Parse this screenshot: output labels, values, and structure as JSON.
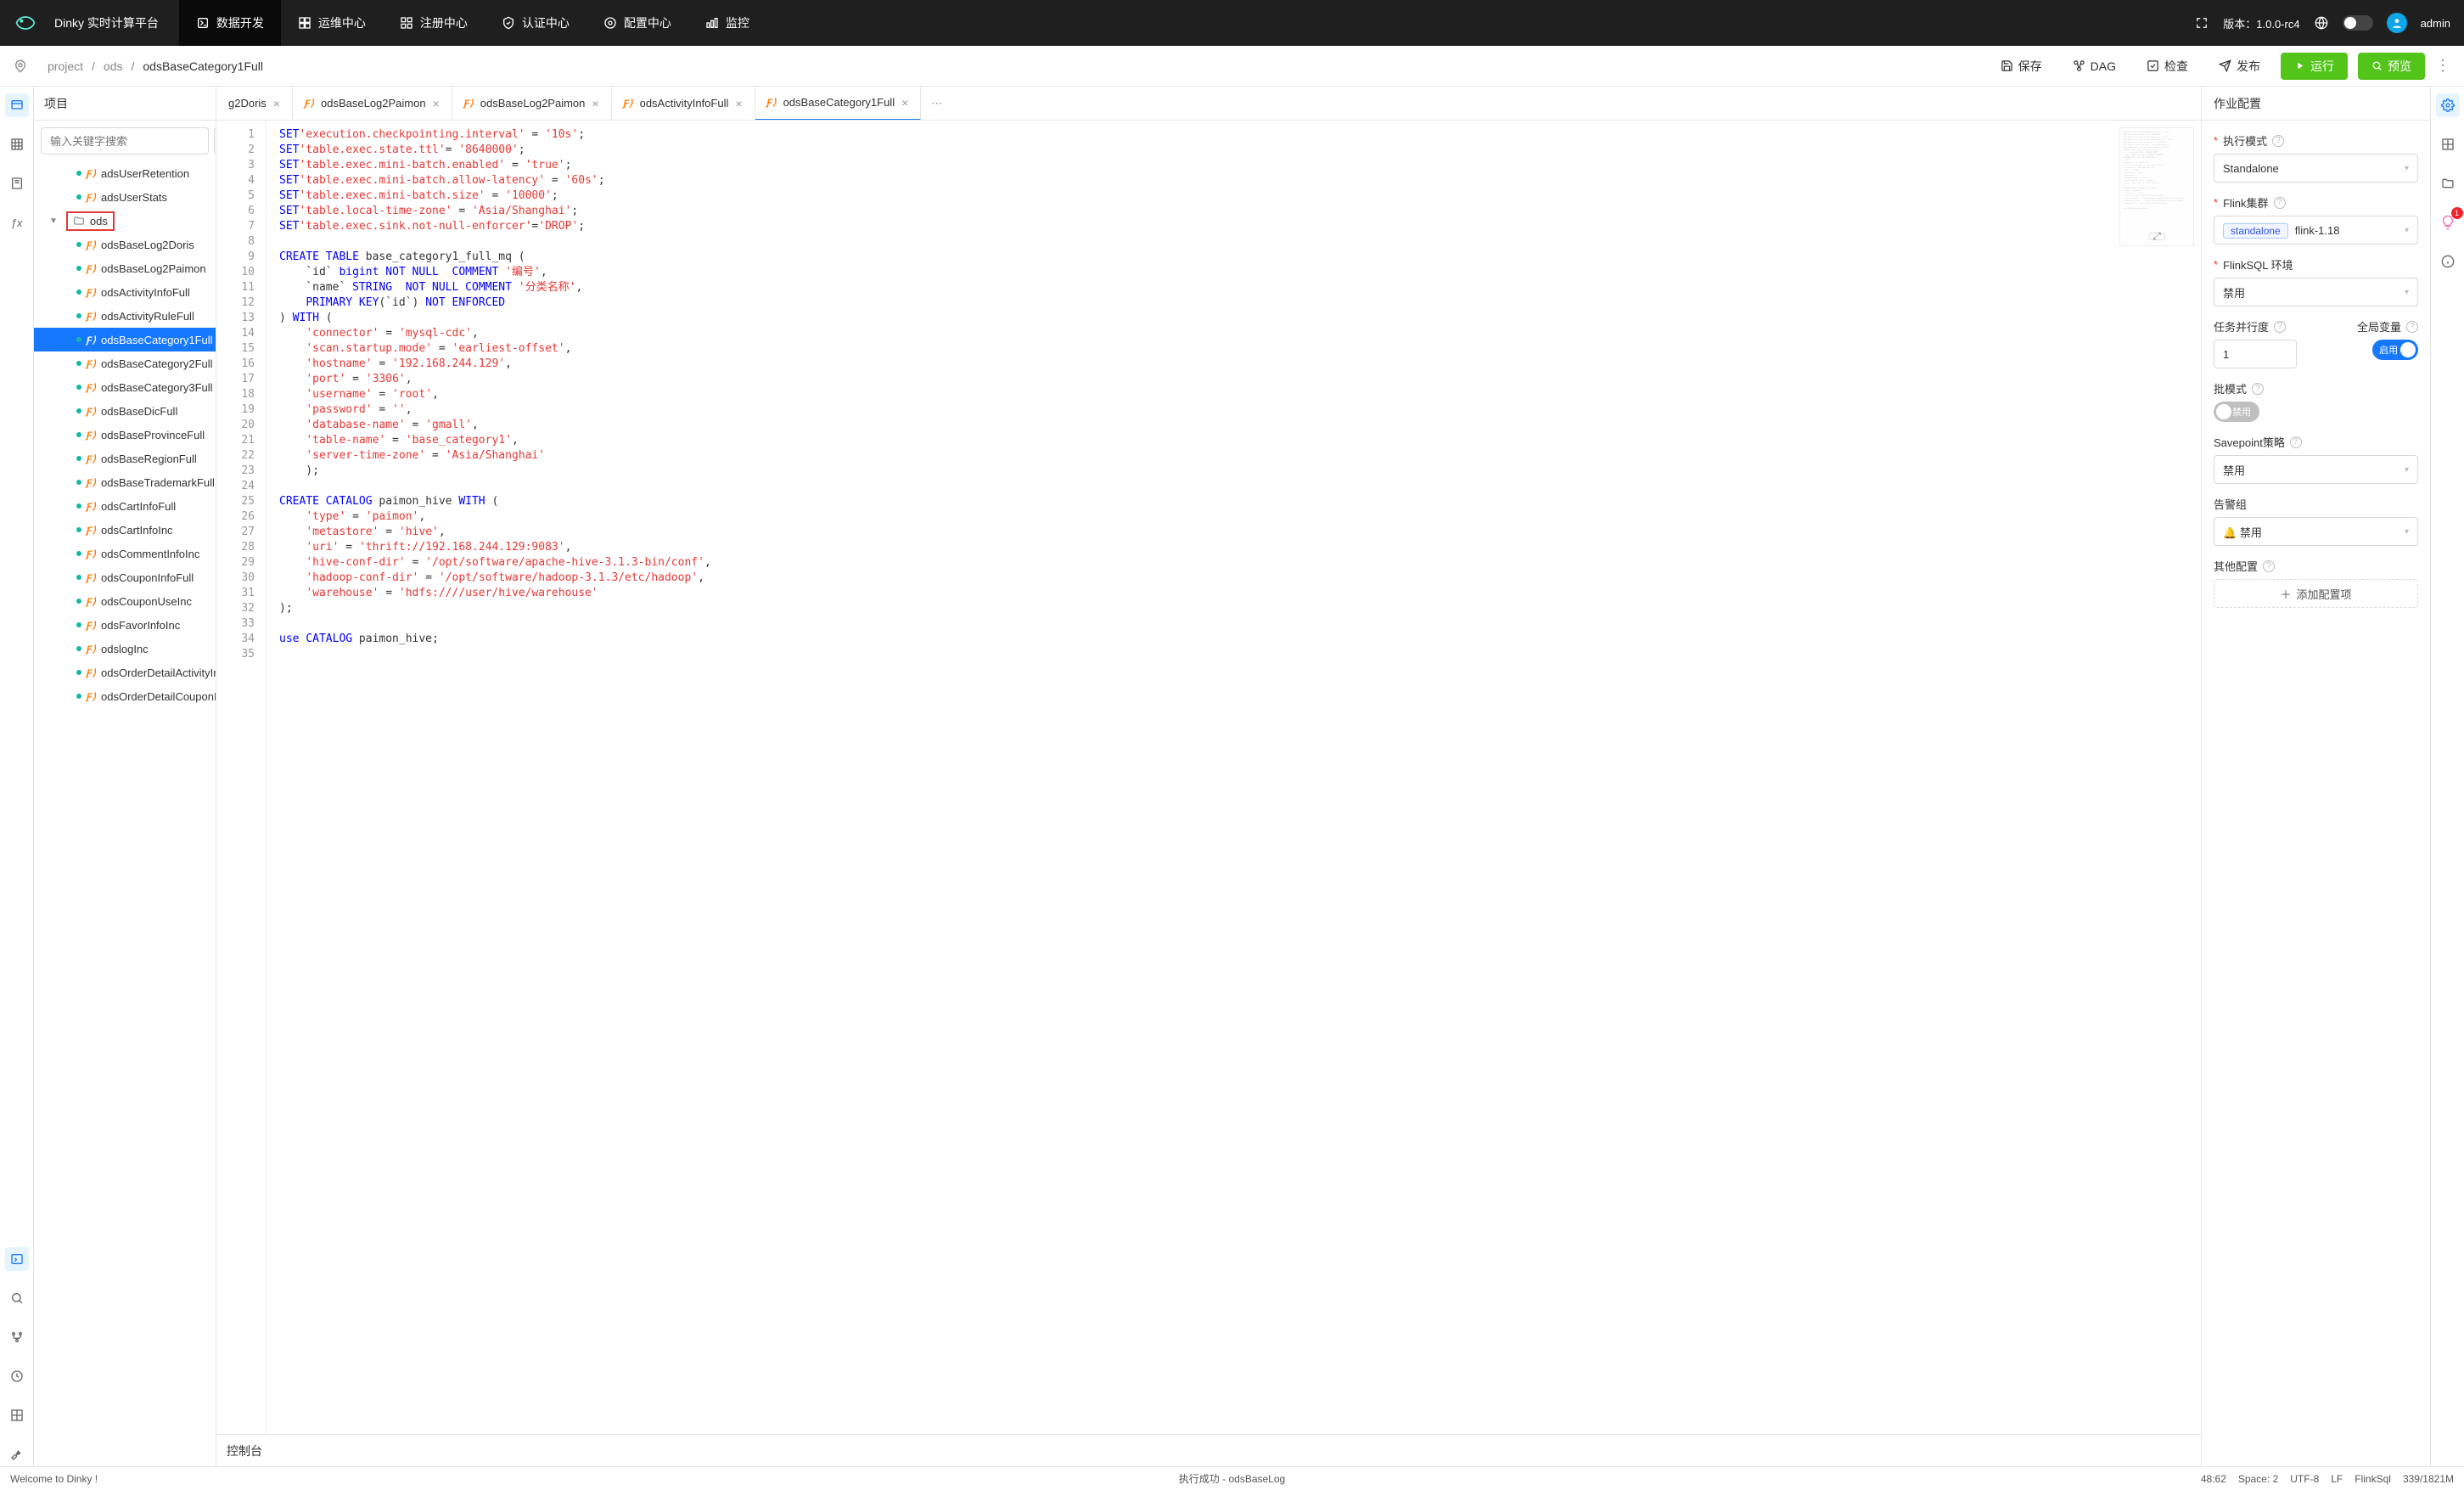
{
  "brand": "Dinky 实时计算平台",
  "nav": {
    "items": [
      {
        "label": "数据开发",
        "active": true
      },
      {
        "label": "运维中心"
      },
      {
        "label": "注册中心"
      },
      {
        "label": "认证中心"
      },
      {
        "label": "配置中心"
      },
      {
        "label": "监控"
      }
    ]
  },
  "topright": {
    "version_label": "版本：",
    "version_value": "1.0.0-rc4",
    "user": "admin"
  },
  "breadcrumb": {
    "parts": [
      "project",
      "ods"
    ],
    "current": "odsBaseCategory1Full"
  },
  "actions": {
    "save": "保存",
    "dag": "DAG",
    "check": "检查",
    "publish": "发布",
    "run": "运行",
    "preview": "预览"
  },
  "tree": {
    "title": "项目",
    "search_placeholder": "输入关键字搜索",
    "items": [
      {
        "label": "adsUserRetention",
        "kind": "file"
      },
      {
        "label": "adsUserStats",
        "kind": "file"
      },
      {
        "label": "ods",
        "kind": "folder",
        "highlighted": true
      },
      {
        "label": "odsBaseLog2Doris",
        "kind": "file"
      },
      {
        "label": "odsBaseLog2Paimon",
        "kind": "file"
      },
      {
        "label": "odsActivityInfoFull",
        "kind": "file"
      },
      {
        "label": "odsActivityRuleFull",
        "kind": "file"
      },
      {
        "label": "odsBaseCategory1Full",
        "kind": "file",
        "selected": true
      },
      {
        "label": "odsBaseCategory2Full",
        "kind": "file"
      },
      {
        "label": "odsBaseCategory3Full",
        "kind": "file"
      },
      {
        "label": "odsBaseDicFull",
        "kind": "file"
      },
      {
        "label": "odsBaseProvinceFull",
        "kind": "file"
      },
      {
        "label": "odsBaseRegionFull",
        "kind": "file"
      },
      {
        "label": "odsBaseTrademarkFull",
        "kind": "file"
      },
      {
        "label": "odsCartInfoFull",
        "kind": "file"
      },
      {
        "label": "odsCartInfoInc",
        "kind": "file"
      },
      {
        "label": "odsCommentInfoInc",
        "kind": "file"
      },
      {
        "label": "odsCouponInfoFull",
        "kind": "file"
      },
      {
        "label": "odsCouponUseInc",
        "kind": "file"
      },
      {
        "label": "odsFavorInfoInc",
        "kind": "file"
      },
      {
        "label": "odslogInc",
        "kind": "file"
      },
      {
        "label": "odsOrderDetailActivityInc",
        "kind": "file"
      },
      {
        "label": "odsOrderDetailCouponInc",
        "kind": "file"
      }
    ]
  },
  "tabs": [
    {
      "label": "g2Doris",
      "partial": true
    },
    {
      "label": "odsBaseLog2Paimon"
    },
    {
      "label": "odsBaseLog2Paimon"
    },
    {
      "label": "odsActivityInfoFull"
    },
    {
      "label": "odsBaseCategory1Full",
      "active": true
    }
  ],
  "code": {
    "lines": [
      [
        [
          "kw",
          "SET"
        ],
        [
          "",
          ""
        ],
        [
          "str",
          "'execution.checkpointing.interval'"
        ],
        [
          "",
          " = "
        ],
        [
          "str",
          "'10s'"
        ],
        [
          "",
          ";"
        ]
      ],
      [
        [
          "kw",
          "SET"
        ],
        [
          "",
          ""
        ],
        [
          "str",
          "'table.exec.state.ttl'"
        ],
        [
          "",
          "= "
        ],
        [
          "str",
          "'8640000'"
        ],
        [
          "",
          ";"
        ]
      ],
      [
        [
          "kw",
          "SET"
        ],
        [
          "",
          ""
        ],
        [
          "str",
          "'table.exec.mini-batch.enabled'"
        ],
        [
          "",
          " = "
        ],
        [
          "str",
          "'true'"
        ],
        [
          "",
          ";"
        ]
      ],
      [
        [
          "kw",
          "SET"
        ],
        [
          "",
          ""
        ],
        [
          "str",
          "'table.exec.mini-batch.allow-latency'"
        ],
        [
          "",
          " = "
        ],
        [
          "str",
          "'60s'"
        ],
        [
          "",
          ";"
        ]
      ],
      [
        [
          "kw",
          "SET"
        ],
        [
          "",
          ""
        ],
        [
          "str",
          "'table.exec.mini-batch.size'"
        ],
        [
          "",
          " = "
        ],
        [
          "str",
          "'10000'"
        ],
        [
          "",
          ";"
        ]
      ],
      [
        [
          "kw",
          "SET"
        ],
        [
          "",
          ""
        ],
        [
          "str",
          "'table.local-time-zone'"
        ],
        [
          "",
          " = "
        ],
        [
          "str",
          "'Asia/Shanghai'"
        ],
        [
          "",
          ";"
        ]
      ],
      [
        [
          "kw",
          "SET"
        ],
        [
          "",
          ""
        ],
        [
          "str",
          "'table.exec.sink.not-null-enforcer'"
        ],
        [
          "",
          "="
        ],
        [
          "str",
          "'DROP'"
        ],
        [
          "",
          ";"
        ]
      ],
      [
        [
          "",
          ""
        ]
      ],
      [
        [
          "kw",
          "CREATE TABLE"
        ],
        [
          "",
          " base_category1_full_mq ("
        ]
      ],
      [
        [
          "",
          "    `id` "
        ],
        [
          "kw",
          "bigint"
        ],
        [
          "",
          " "
        ],
        [
          "kw",
          "NOT NULL"
        ],
        [
          "",
          "  "
        ],
        [
          "kw",
          "COMMENT"
        ],
        [
          "",
          " "
        ],
        [
          "str",
          "'编号'"
        ],
        [
          "",
          ","
        ]
      ],
      [
        [
          "",
          "    `name` "
        ],
        [
          "kw",
          "STRING"
        ],
        [
          "",
          "  "
        ],
        [
          "kw",
          "NOT NULL"
        ],
        [
          "",
          " "
        ],
        [
          "kw",
          "COMMENT"
        ],
        [
          "",
          " "
        ],
        [
          "str",
          "'分类名称'"
        ],
        [
          "",
          ","
        ]
      ],
      [
        [
          "",
          "    "
        ],
        [
          "kw",
          "PRIMARY KEY"
        ],
        [
          "",
          "(`id`) "
        ],
        [
          "kw",
          "NOT ENFORCED"
        ]
      ],
      [
        [
          "",
          ") "
        ],
        [
          "kw",
          "WITH"
        ],
        [
          "",
          " ("
        ]
      ],
      [
        [
          "",
          "    "
        ],
        [
          "str",
          "'connector'"
        ],
        [
          "",
          " = "
        ],
        [
          "str",
          "'mysql-cdc'"
        ],
        [
          "",
          ","
        ]
      ],
      [
        [
          "",
          "    "
        ],
        [
          "str",
          "'scan.startup.mode'"
        ],
        [
          "",
          " = "
        ],
        [
          "str",
          "'earliest-offset'"
        ],
        [
          "",
          ","
        ]
      ],
      [
        [
          "",
          "    "
        ],
        [
          "str",
          "'hostname'"
        ],
        [
          "",
          " = "
        ],
        [
          "str",
          "'192.168.244.129'"
        ],
        [
          "",
          ","
        ]
      ],
      [
        [
          "",
          "    "
        ],
        [
          "str",
          "'port'"
        ],
        [
          "",
          " = "
        ],
        [
          "str",
          "'3306'"
        ],
        [
          "",
          ","
        ]
      ],
      [
        [
          "",
          "    "
        ],
        [
          "str",
          "'username'"
        ],
        [
          "",
          " = "
        ],
        [
          "str",
          "'root'"
        ],
        [
          "",
          ","
        ]
      ],
      [
        [
          "",
          "    "
        ],
        [
          "str",
          "'password'"
        ],
        [
          "",
          " = "
        ],
        [
          "str",
          "''"
        ],
        [
          "",
          ","
        ]
      ],
      [
        [
          "",
          "    "
        ],
        [
          "str",
          "'database-name'"
        ],
        [
          "",
          " = "
        ],
        [
          "str",
          "'gmall'"
        ],
        [
          "",
          ","
        ]
      ],
      [
        [
          "",
          "    "
        ],
        [
          "str",
          "'table-name'"
        ],
        [
          "",
          " = "
        ],
        [
          "str",
          "'base_category1'"
        ],
        [
          "",
          ","
        ]
      ],
      [
        [
          "",
          "    "
        ],
        [
          "str",
          "'server-time-zone'"
        ],
        [
          "",
          " = "
        ],
        [
          "str",
          "'Asia/Shanghai'"
        ]
      ],
      [
        [
          "",
          "    );"
        ]
      ],
      [
        [
          "",
          ""
        ]
      ],
      [
        [
          "kw",
          "CREATE CATALOG"
        ],
        [
          "",
          " paimon_hive "
        ],
        [
          "kw",
          "WITH"
        ],
        [
          "",
          " ("
        ]
      ],
      [
        [
          "",
          "    "
        ],
        [
          "str",
          "'type'"
        ],
        [
          "",
          " = "
        ],
        [
          "str",
          "'paimon'"
        ],
        [
          "",
          ","
        ]
      ],
      [
        [
          "",
          "    "
        ],
        [
          "str",
          "'metastore'"
        ],
        [
          "",
          " = "
        ],
        [
          "str",
          "'hive'"
        ],
        [
          "",
          ","
        ]
      ],
      [
        [
          "",
          "    "
        ],
        [
          "str",
          "'uri'"
        ],
        [
          "",
          " = "
        ],
        [
          "str",
          "'thrift://192.168.244.129:9083'"
        ],
        [
          "",
          ","
        ]
      ],
      [
        [
          "",
          "    "
        ],
        [
          "str",
          "'hive-conf-dir'"
        ],
        [
          "",
          " = "
        ],
        [
          "str",
          "'/opt/software/apache-hive-3.1.3-bin/conf'"
        ],
        [
          "",
          ","
        ]
      ],
      [
        [
          "",
          "    "
        ],
        [
          "str",
          "'hadoop-conf-dir'"
        ],
        [
          "",
          " = "
        ],
        [
          "str",
          "'/opt/software/hadoop-3.1.3/etc/hadoop'"
        ],
        [
          "",
          ","
        ]
      ],
      [
        [
          "",
          "    "
        ],
        [
          "str",
          "'warehouse'"
        ],
        [
          "",
          " = "
        ],
        [
          "str",
          "'hdfs:////user/hive/warehouse'"
        ]
      ],
      [
        [
          "",
          ");"
        ]
      ],
      [
        [
          "",
          ""
        ]
      ],
      [
        [
          "kw",
          "use CATALOG"
        ],
        [
          "",
          " paimon_hive;"
        ]
      ],
      [
        [
          "",
          ""
        ]
      ]
    ]
  },
  "console": {
    "title": "控制台"
  },
  "config": {
    "title": "作业配置",
    "exec_mode": {
      "label": "执行模式",
      "value": "Standalone"
    },
    "cluster": {
      "label": "Flink集群",
      "tag": "standalone",
      "value": "flink-1.18"
    },
    "env": {
      "label": "FlinkSQL 环境",
      "value": "禁用"
    },
    "parallelism": {
      "label": "任务并行度",
      "value": "1"
    },
    "globalvar": {
      "label": "全局变量",
      "value": "启用"
    },
    "batch": {
      "label": "批模式",
      "value": "禁用"
    },
    "savepoint": {
      "label": "Savepoint策略",
      "value": "禁用"
    },
    "alert": {
      "label": "告警组",
      "value": "禁用"
    },
    "other": {
      "label": "其他配置"
    },
    "add_btn": "添加配置项"
  },
  "statusbar": {
    "welcome": "Welcome to Dinky !",
    "exec": "执行成功  -  odsBaseLog",
    "pos": "48:62",
    "space": "Space: 2",
    "encoding": "UTF-8",
    "eol": "LF",
    "lang": "FlinkSql",
    "lines": "339/1821M"
  },
  "bulb_badge": "1"
}
